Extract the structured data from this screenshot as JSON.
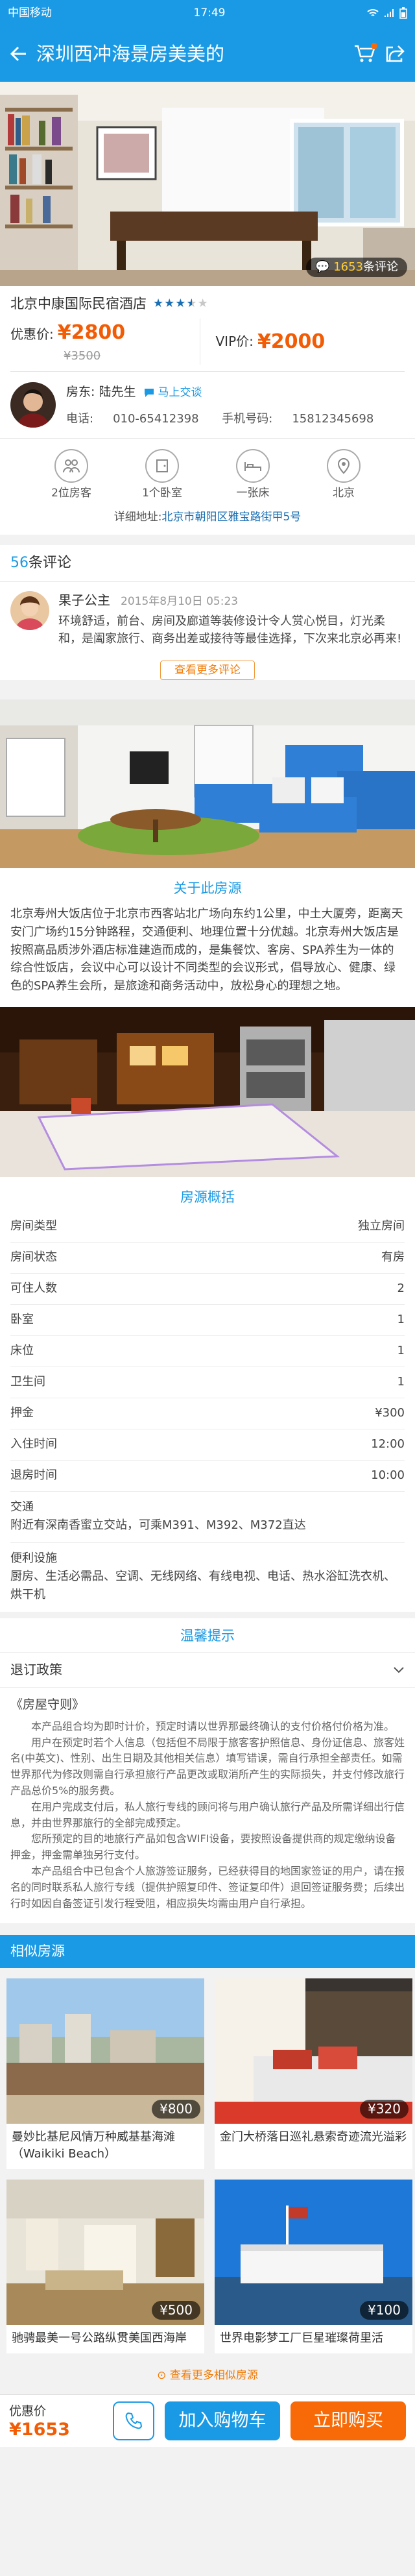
{
  "status_bar": {
    "carrier": "中国移动",
    "time": "17:49"
  },
  "header": {
    "title": "深圳西冲海景房美美的",
    "cart_badge": ""
  },
  "hero": {
    "review_count": "1653",
    "review_suffix": "条评论"
  },
  "hotel": {
    "name": "北京中康国际民宿酒店",
    "rating": 3.5,
    "rating_stars": 5,
    "member_price_label": "优惠价:",
    "member_price": "¥2800",
    "original_price": "¥3500",
    "vip_price_label": "VIP价:",
    "vip_price": "¥2000"
  },
  "host": {
    "label": "房东:",
    "name": "陆先生",
    "chat_label": "马上交谈",
    "phone_label": "电话:",
    "phone": "010-65412398",
    "mobile_label": "手机号码:",
    "mobile": "15812345698"
  },
  "facilities": [
    {
      "icon": "guests-icon",
      "label": "2位房客"
    },
    {
      "icon": "bedroom-icon",
      "label": "1个卧室"
    },
    {
      "icon": "bed-icon",
      "label": "一张床"
    },
    {
      "icon": "location-pin-icon",
      "label": "北京"
    }
  ],
  "address": {
    "label": "详细地址:",
    "value": "北京市朝阳区雅宝路街甲5号"
  },
  "reviews": {
    "count": "56",
    "label": "条评论",
    "items": [
      {
        "name": "果子公主",
        "date": "2015年8月10日  05:23",
        "text": "环境舒适，前台、房间及廊道等装修设计令人赏心悦目，灯光柔和，是阖家旅行、商务出差或接待等最佳选择，下次来北京必再来!"
      }
    ],
    "more_label": "查看更多评论"
  },
  "about": {
    "title": "关于此房源",
    "text": "北京寿州大饭店位于北京市西客站北广场向东约1公里，中土大厦旁，距离天安门广场约15分钟路程，交通便利、地理位置十分优越。北京寿州大饭店是按照高品质涉外酒店标准建造而成的，是集餐饮、客房、SPA养生为一体的综合性饭店，会议中心可以设计不同类型的会议形式，倡导放心、健康、绿色的SPA养生会所，是旅途和商务活动中，放松身心的理想之地。"
  },
  "overview": {
    "title": "房源概括",
    "rows": [
      {
        "label": "房间类型",
        "value": "独立房间"
      },
      {
        "label": "房间状态",
        "value": "有房"
      },
      {
        "label": "可住人数",
        "value": "2"
      },
      {
        "label": "卧室",
        "value": "1"
      },
      {
        "label": "床位",
        "value": "1"
      },
      {
        "label": "卫生间",
        "value": "1"
      },
      {
        "label": "押金",
        "value": "¥300"
      },
      {
        "label": "入住时间",
        "value": "12:00"
      },
      {
        "label": "退房时间",
        "value": "10:00"
      }
    ],
    "transport_label": "交通",
    "transport_text": "附近有深南香蜜立交站，可乘M391、M392、M372直达",
    "amenities_label": "便利设施",
    "amenities_text": "厨房、生活必需品、空调、无线网络、有线电视、电话、热水浴缸洗衣机、烘干机"
  },
  "notice": {
    "title": "温馨提示",
    "policy_label": "退订政策",
    "rules_title": "《房屋守则》",
    "paragraphs": [
      "本产品组合均为即时计价，预定时请以世界那最终确认的支付价格付价格为准。",
      "用户在预定时若个人信息（包括但不局限于旅客客护照信息、身份证信息、旅客姓名(中英文)、性别、出生日期及其他相关信息）填写错误，需自行承担全部责任。如需世界那代为修改则需自行承担旅行产品更改或取消所产生的实际损失，并支付修改旅行产品总价5%的服务费。",
      "在用户完成支付后，私人旅行专线的顾问将与用户确认旅行产品及所需详细出行信息，并由世界那旅行的全部完成预定。",
      "您所预定的目的地旅行产品如包含WIFI设备，要按照设备提供商的规定缴纳设备押金，押金需单独另行支付。",
      "本产品组合中已包含个人旅游签证服务，已经获得目的地国家签证的用户，请在报名的同时联系私人旅行专线（提供护照复印件、签证复印件）退回签证服务费；后续出行时如因自备签证引发行程受阻，相应损失均需由用户自行承担。"
    ]
  },
  "similar": {
    "title": "相似房源",
    "items": [
      {
        "price": "¥800",
        "title": "曼妙比基尼风情万种威基基海滩（Waikiki Beach）"
      },
      {
        "price": "¥320",
        "title": "金门大桥落日巡礼悬索奇迹流光溢彩"
      },
      {
        "price": "¥500",
        "title": "驰骋最美一号公路纵贯美国西海岸"
      },
      {
        "price": "¥100",
        "title": "世界电影梦工厂巨星璀璨荷里活"
      }
    ],
    "more_label": "查看更多相似房源"
  },
  "bottom_bar": {
    "price_label": "优惠价",
    "price": "¥1653",
    "cart_label": "加入购物车",
    "buy_label": "立即购买"
  },
  "colors": {
    "primary": "#1a9ae5",
    "accent": "#f25c05",
    "buy": "#f86a07"
  }
}
